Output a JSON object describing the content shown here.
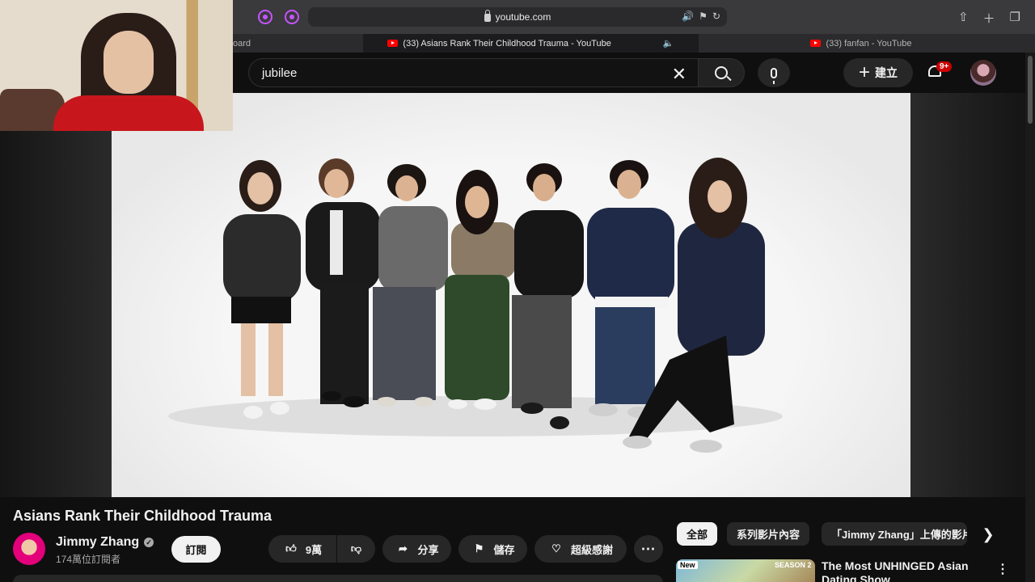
{
  "browser": {
    "url": "youtube.com",
    "tabs": [
      {
        "label": "oard",
        "active": false
      },
      {
        "label": "(33) Asians Rank Their Childhood Trauma - YouTube",
        "active": true
      },
      {
        "label": "(33) fanfan - YouTube",
        "active": false
      }
    ],
    "accent": "#c653ff"
  },
  "header": {
    "search_value": "jubilee",
    "create_label": "建立",
    "notifications_badge": "9+"
  },
  "video": {
    "title": "Asians Rank Their Childhood Trauma",
    "channel_name": "Jimmy Zhang",
    "subscribers": "174萬位訂閱者",
    "subscribe_label": "訂閱",
    "likes": "9萬",
    "share_label": "分享",
    "save_label": "儲存",
    "thanks_label": "超級感謝"
  },
  "chips": [
    {
      "label": "全部",
      "active": true
    },
    {
      "label": "系列影片內容",
      "active": false
    },
    {
      "label": "「Jimmy Zhang」上傳的影片",
      "active": false
    }
  ],
  "recommendation": {
    "title": "The Most UNHINGED Asian Dating Show",
    "badge": "New",
    "season": "SEASON 2"
  },
  "colors": {
    "background": "#0f0f0f",
    "pill": "#272727",
    "brand_red": "#ff0000"
  }
}
